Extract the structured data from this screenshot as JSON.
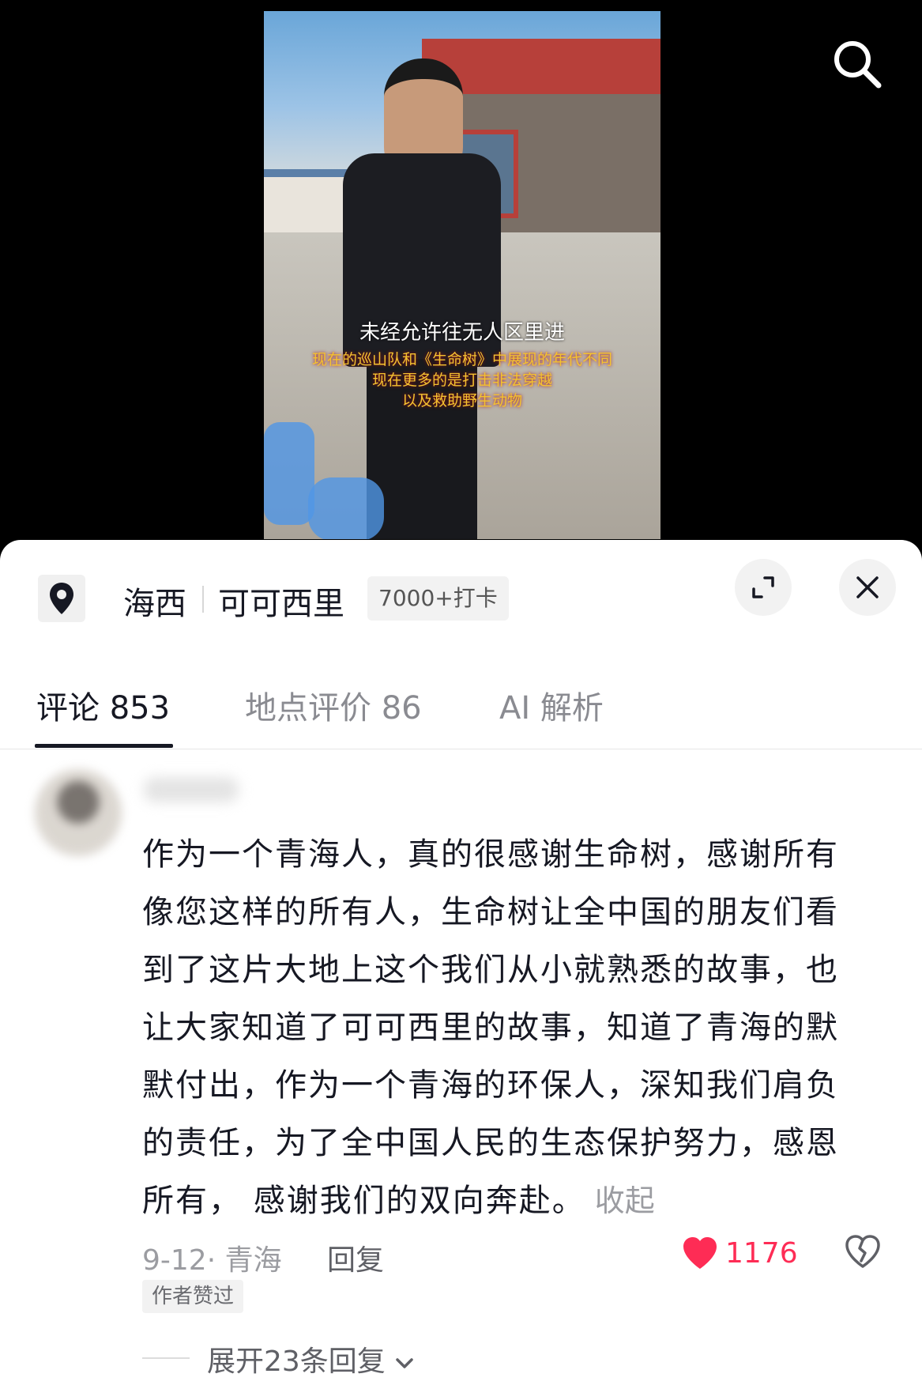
{
  "video": {
    "subtitle_main": "未经允许往无人区里进",
    "subtitle_lines": [
      "现在的巡山队和《生命树》中展现的年代不同",
      "现在更多的是打击非法穿越",
      "以及救助野生动物"
    ]
  },
  "location": {
    "region": "海西",
    "place": "可可西里",
    "checkin": "7000+打卡"
  },
  "tabs": [
    {
      "label": "评论 853",
      "active": true
    },
    {
      "label": "地点评价 86",
      "active": false
    },
    {
      "label": "AI 解析",
      "active": false
    }
  ],
  "comment": {
    "lines": [
      "作为一个青海人，真的很感谢生命树，感谢所有",
      "像您这样的所有人，生命树让全中国的朋友们看",
      "到了这片大地上这个我们从小就熟悉的故事，也",
      "让大家知道了可可西里的故事，知道了青海的默",
      "默付出，作为一个青海的环保人，深知我们肩负",
      "的责任，为了全中国人民的生态保护努力，感恩",
      "所有， 感谢我们的双向奔赴。"
    ],
    "collapse_label": "收起",
    "date_location": "9-12· 青海",
    "reply_label": "回复",
    "like_count": "1176",
    "author_badge": "作者赞过",
    "expand_replies": "展开23条回复"
  },
  "colors": {
    "like": "#fe2c55",
    "text_primary": "#161823",
    "text_secondary": "#9b9ca1"
  }
}
